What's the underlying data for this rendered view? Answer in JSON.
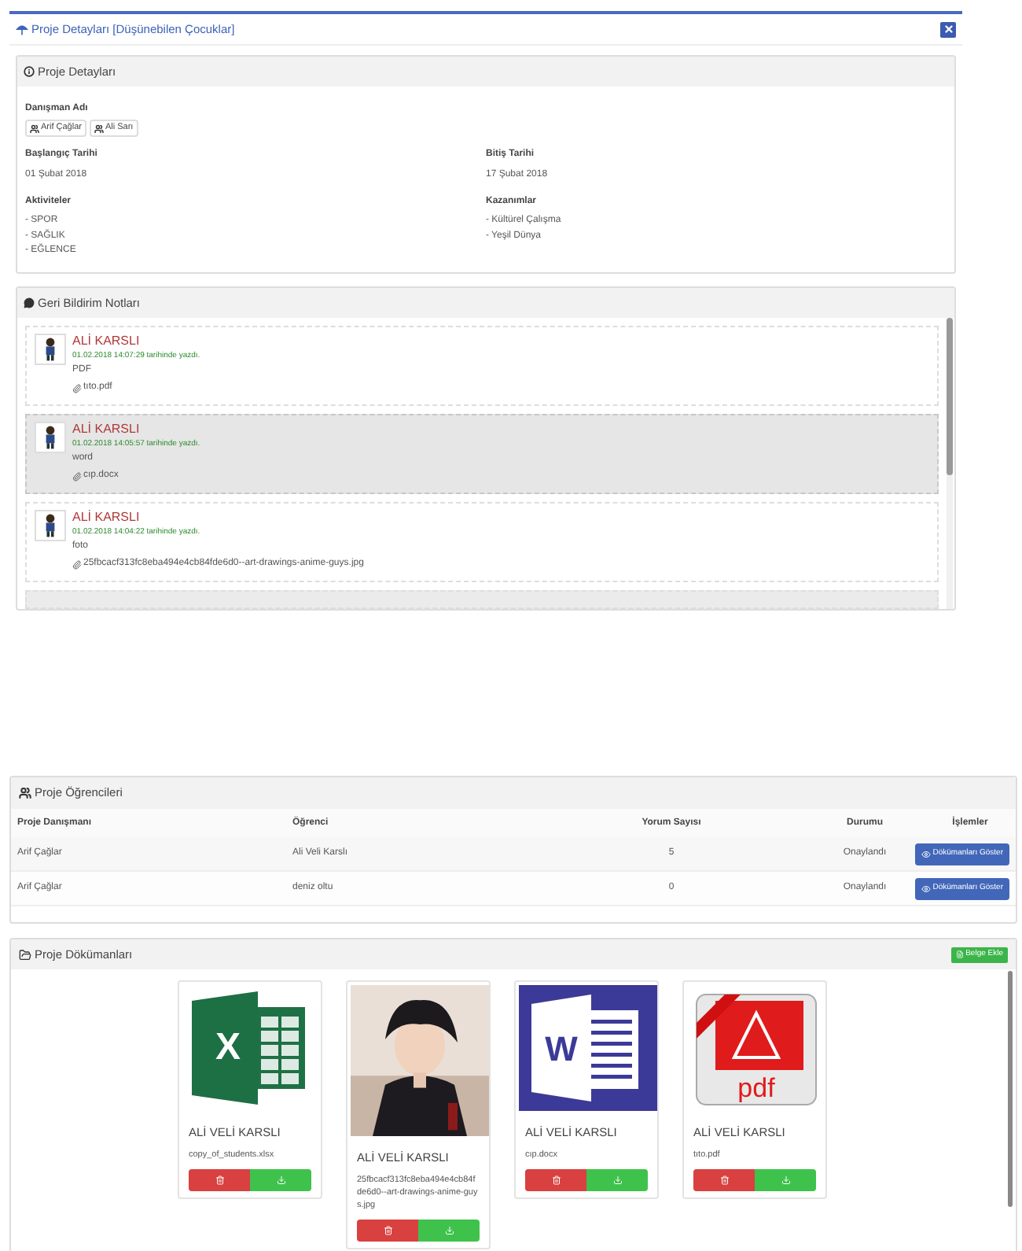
{
  "modal": {
    "title": "Proje Detayları [Düşünebilen Çocuklar]"
  },
  "details": {
    "title": "Proje Detayları",
    "advisor_label": "Danışman Adı",
    "advisors": [
      "Arif Çağlar",
      "Ali Sarı"
    ],
    "start_label": "Başlangıç Tarihi",
    "start": "01 Şubat 2018",
    "end_label": "Bitiş Tarihi",
    "end": "17 Şubat 2018",
    "activities_label": "Aktiviteler",
    "activities": [
      "- SPOR",
      "- SAĞLIK",
      "- EĞLENCE"
    ],
    "gains_label": "Kazanımlar",
    "gains": [
      "- Kültürel Çalışma",
      "- Yeşil Dünya"
    ]
  },
  "feedback": {
    "title": "Geri Bildirim Notları",
    "notes": [
      {
        "author": "ALİ KARSLI",
        "date": "01.02.2018 14:07:29 tarihinde yazdı.",
        "text": "PDF",
        "file": "tıto.pdf",
        "selected": false
      },
      {
        "author": "ALİ KARSLI",
        "date": "01.02.2018 14:05:57 tarihinde yazdı.",
        "text": "word",
        "file": "cıp.docx",
        "selected": true
      },
      {
        "author": "ALİ KARSLI",
        "date": "01.02.2018 14:04:22 tarihinde yazdı.",
        "text": "foto",
        "file": "25fbcacf313fc8eba494e4cb84fde6d0--art-drawings-anime-guys.jpg",
        "selected": false
      }
    ]
  },
  "students": {
    "title": "Proje Öğrencileri",
    "columns": [
      "Proje Danışmanı",
      "Öğrenci",
      "Yorum Sayısı",
      "Durumu",
      "İşlemler"
    ],
    "rows": [
      {
        "advisor": "Arif Çağlar",
        "student": "Ali Veli Karslı",
        "comments": "5",
        "status": "Onaylandı",
        "action": "Dökümanları Göster"
      },
      {
        "advisor": "Arif Çağlar",
        "student": "deniz oltu",
        "comments": "0",
        "status": "Onaylandı",
        "action": "Dökümanları Göster"
      }
    ]
  },
  "documents": {
    "title": "Proje Dökümanları",
    "add_button": "Belge Ekle",
    "items": [
      {
        "kind": "excel",
        "logo": "X",
        "owner": "ALİ VELİ KARSLI",
        "file": "copy_of_students.xlsx"
      },
      {
        "kind": "picture",
        "owner": "ALİ VELİ KARSLI",
        "file": "25fbcacf313fc8eba494e4cb84fde6d0--art-drawings-anime-guys.jpg"
      },
      {
        "kind": "word",
        "logo": "W",
        "owner": "ALİ VELİ KARSLI",
        "file": "cıp.docx"
      },
      {
        "kind": "pdf",
        "logo": "pdf",
        "owner": "ALİ VELİ KARSLI",
        "file": "tıto.pdf"
      }
    ]
  }
}
